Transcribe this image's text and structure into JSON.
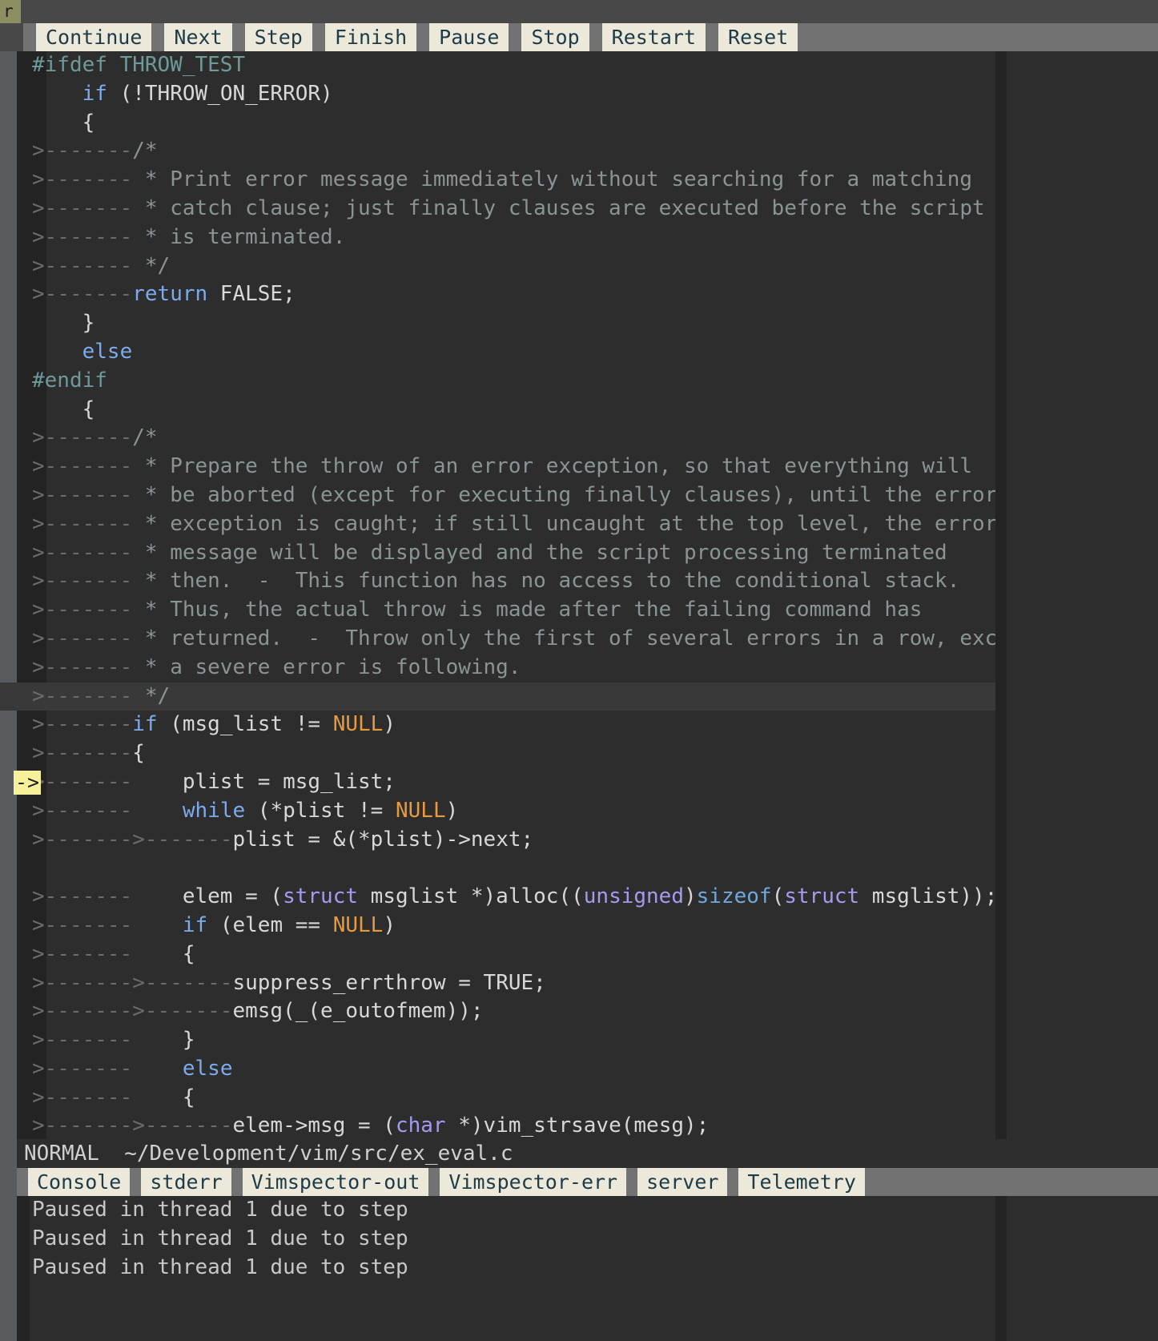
{
  "tabline": {
    "active_tab_label": "r"
  },
  "winbar": {
    "buttons": [
      {
        "label": "Continue",
        "name": "continue-button"
      },
      {
        "label": "Next",
        "name": "next-button"
      },
      {
        "label": "Step",
        "name": "step-button"
      },
      {
        "label": "Finish",
        "name": "finish-button"
      },
      {
        "label": "Pause",
        "name": "pause-button"
      },
      {
        "label": "Stop",
        "name": "stop-button"
      },
      {
        "label": "Restart",
        "name": "restart-button"
      },
      {
        "label": "Reset",
        "name": "reset-button"
      }
    ]
  },
  "editor": {
    "sign_marker": "->",
    "cursor_line_index": 22,
    "marker_line_index": 25,
    "lines": [
      {
        "tabs": 0,
        "segs": [
          {
            "t": "#ifdef THROW_TEST",
            "c": "s-pre"
          }
        ]
      },
      {
        "tabs": 0,
        "segs": [
          {
            "t": "    ",
            "c": "s-txt"
          },
          {
            "t": "if",
            "c": "s-kw"
          },
          {
            "t": " (!THROW_ON_ERROR)",
            "c": "s-txt"
          }
        ]
      },
      {
        "tabs": 0,
        "segs": [
          {
            "t": "    {",
            "c": "s-txt"
          }
        ]
      },
      {
        "tabs": 1,
        "segs": [
          {
            "t": "/*",
            "c": "s-cmt"
          }
        ]
      },
      {
        "tabs": 1,
        "segs": [
          {
            "t": " * Print error message immediately without searching for a matching",
            "c": "s-cmt"
          }
        ]
      },
      {
        "tabs": 1,
        "segs": [
          {
            "t": " * catch clause; just finally clauses are executed before the script",
            "c": "s-cmt"
          }
        ]
      },
      {
        "tabs": 1,
        "segs": [
          {
            "t": " * is terminated.",
            "c": "s-cmt"
          }
        ]
      },
      {
        "tabs": 1,
        "segs": [
          {
            "t": " */",
            "c": "s-cmt"
          }
        ]
      },
      {
        "tabs": 1,
        "segs": [
          {
            "t": "return",
            "c": "s-kw"
          },
          {
            "t": " FALSE;",
            "c": "s-txt"
          }
        ]
      },
      {
        "tabs": 0,
        "segs": [
          {
            "t": "    }",
            "c": "s-txt"
          }
        ]
      },
      {
        "tabs": 0,
        "segs": [
          {
            "t": "    ",
            "c": "s-txt"
          },
          {
            "t": "else",
            "c": "s-kw"
          }
        ]
      },
      {
        "tabs": 0,
        "segs": [
          {
            "t": "#endif",
            "c": "s-pre"
          }
        ]
      },
      {
        "tabs": 0,
        "segs": [
          {
            "t": "    {",
            "c": "s-txt"
          }
        ]
      },
      {
        "tabs": 1,
        "segs": [
          {
            "t": "/*",
            "c": "s-cmt"
          }
        ]
      },
      {
        "tabs": 1,
        "segs": [
          {
            "t": " * Prepare the throw of an error exception, so that everything will",
            "c": "s-cmt"
          }
        ]
      },
      {
        "tabs": 1,
        "segs": [
          {
            "t": " * be aborted (except for executing finally clauses), until the error",
            "c": "s-cmt"
          }
        ]
      },
      {
        "tabs": 1,
        "segs": [
          {
            "t": " * exception is caught; if still uncaught at the top level, the error",
            "c": "s-cmt"
          }
        ]
      },
      {
        "tabs": 1,
        "segs": [
          {
            "t": " * message will be displayed and the script processing terminated",
            "c": "s-cmt"
          }
        ]
      },
      {
        "tabs": 1,
        "segs": [
          {
            "t": " * then.  -  This function has no access to the conditional stack.",
            "c": "s-cmt"
          }
        ]
      },
      {
        "tabs": 1,
        "segs": [
          {
            "t": " * Thus, the actual throw is made after the failing command has",
            "c": "s-cmt"
          }
        ]
      },
      {
        "tabs": 1,
        "segs": [
          {
            "t": " * returned.  -  Throw only the first of several errors in a row, except",
            "c": "s-cmt"
          }
        ]
      },
      {
        "tabs": 1,
        "segs": [
          {
            "t": " * a severe error is following.",
            "c": "s-cmt"
          }
        ]
      },
      {
        "tabs": 1,
        "segs": [
          {
            "t": " */",
            "c": "s-cmt"
          }
        ]
      },
      {
        "tabs": 1,
        "segs": [
          {
            "t": "if",
            "c": "s-kw"
          },
          {
            "t": " (msg_list != ",
            "c": "s-txt"
          },
          {
            "t": "NULL",
            "c": "s-cst"
          },
          {
            "t": ")",
            "c": "s-txt"
          }
        ]
      },
      {
        "tabs": 1,
        "segs": [
          {
            "t": "{",
            "c": "s-txt"
          }
        ]
      },
      {
        "tabs": 1,
        "segs": [
          {
            "t": "    plist = msg_list;",
            "c": "s-txt"
          }
        ]
      },
      {
        "tabs": 1,
        "segs": [
          {
            "t": "    ",
            "c": "s-txt"
          },
          {
            "t": "while",
            "c": "s-kw"
          },
          {
            "t": " (*plist != ",
            "c": "s-txt"
          },
          {
            "t": "NULL",
            "c": "s-cst"
          },
          {
            "t": ")",
            "c": "s-txt"
          }
        ]
      },
      {
        "tabs": 2,
        "segs": [
          {
            "t": "plist = &(*plist)->next;",
            "c": "s-txt"
          }
        ]
      },
      {
        "tabs": 0,
        "segs": [
          {
            "t": "",
            "c": "s-txt"
          }
        ]
      },
      {
        "tabs": 1,
        "segs": [
          {
            "t": "    elem = (",
            "c": "s-txt"
          },
          {
            "t": "struct",
            "c": "s-typ"
          },
          {
            "t": " msglist *)alloc((",
            "c": "s-txt"
          },
          {
            "t": "unsigned",
            "c": "s-typ"
          },
          {
            "t": ")",
            "c": "s-txt"
          },
          {
            "t": "sizeof",
            "c": "s-fn"
          },
          {
            "t": "(",
            "c": "s-txt"
          },
          {
            "t": "struct",
            "c": "s-typ"
          },
          {
            "t": " msglist));",
            "c": "s-txt"
          }
        ]
      },
      {
        "tabs": 1,
        "segs": [
          {
            "t": "    ",
            "c": "s-txt"
          },
          {
            "t": "if",
            "c": "s-kw"
          },
          {
            "t": " (elem == ",
            "c": "s-txt"
          },
          {
            "t": "NULL",
            "c": "s-cst"
          },
          {
            "t": ")",
            "c": "s-txt"
          }
        ]
      },
      {
        "tabs": 1,
        "segs": [
          {
            "t": "    {",
            "c": "s-txt"
          }
        ]
      },
      {
        "tabs": 2,
        "segs": [
          {
            "t": "suppress_errthrow = TRUE;",
            "c": "s-txt"
          }
        ]
      },
      {
        "tabs": 2,
        "segs": [
          {
            "t": "emsg(_(e_outofmem));",
            "c": "s-txt"
          }
        ]
      },
      {
        "tabs": 1,
        "segs": [
          {
            "t": "    }",
            "c": "s-txt"
          }
        ]
      },
      {
        "tabs": 1,
        "segs": [
          {
            "t": "    ",
            "c": "s-txt"
          },
          {
            "t": "else",
            "c": "s-kw"
          }
        ]
      },
      {
        "tabs": 1,
        "segs": [
          {
            "t": "    {",
            "c": "s-txt"
          }
        ]
      },
      {
        "tabs": 2,
        "segs": [
          {
            "t": "elem->msg = (",
            "c": "s-txt"
          },
          {
            "t": "char",
            "c": "s-typ"
          },
          {
            "t": " *)vim_strsave(mesg);",
            "c": "s-txt"
          }
        ]
      }
    ],
    "tab_glyph": ">-------"
  },
  "statusline": {
    "mode": "NORMAL",
    "filepath": "~/Development/vim/src/ex_eval.c"
  },
  "bottom_tabs": [
    {
      "label": "Console",
      "name": "tab-console"
    },
    {
      "label": "stderr",
      "name": "tab-stderr"
    },
    {
      "label": "Vimspector-out",
      "name": "tab-vimspector-out"
    },
    {
      "label": "Vimspector-err",
      "name": "tab-vimspector-err"
    },
    {
      "label": "server",
      "name": "tab-server"
    },
    {
      "label": "Telemetry",
      "name": "tab-telemetry"
    }
  ],
  "console": {
    "lines": [
      "Paused in thread 1 due to step",
      "Paused in thread 1 due to step",
      "Paused in thread 1 due to step"
    ]
  },
  "colors": {
    "winbar_bg": "#727272",
    "button_bg": "#ece8da",
    "button_fg": "#1d3b47",
    "editor_bg": "#2d2d2d",
    "cursorline_bg": "#393939",
    "sign_bg": "#f6f19a",
    "tab_active_bg": "#8d8f63",
    "comment": "#8a9496",
    "keyword": "#7daaea",
    "constant": "#e89a3c",
    "type": "#a29cf0",
    "preproc": "#6f9a9a"
  }
}
